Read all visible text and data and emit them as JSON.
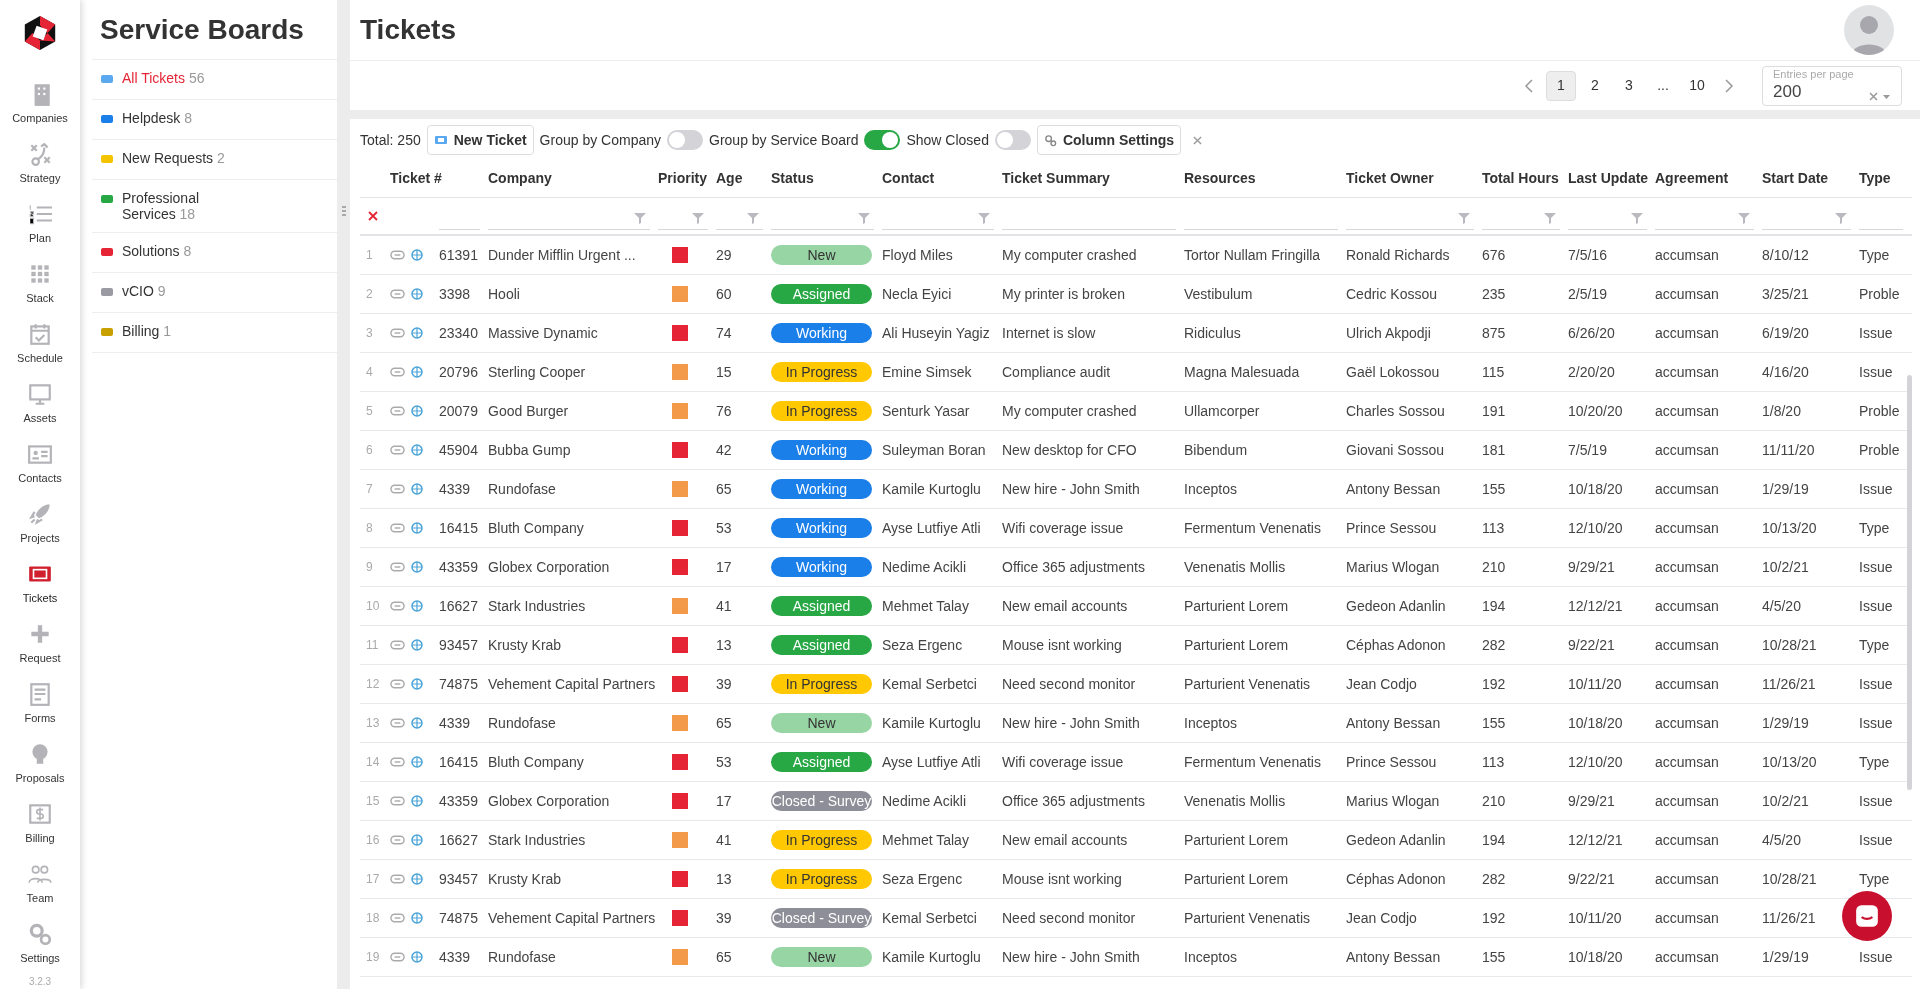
{
  "nav": {
    "items": [
      {
        "label": "Companies",
        "selected": false
      },
      {
        "label": "Strategy",
        "selected": false
      },
      {
        "label": "Plan",
        "selected": false
      },
      {
        "label": "Stack",
        "selected": false
      },
      {
        "label": "Schedule",
        "selected": false
      },
      {
        "label": "Assets",
        "selected": false
      },
      {
        "label": "Contacts",
        "selected": false
      },
      {
        "label": "Projects",
        "selected": false
      },
      {
        "label": "Tickets",
        "selected": true
      },
      {
        "label": "Request",
        "selected": false
      },
      {
        "label": "Forms",
        "selected": false
      },
      {
        "label": "Proposals",
        "selected": false
      },
      {
        "label": "Billing",
        "selected": false
      },
      {
        "label": "Team",
        "selected": false
      },
      {
        "label": "Settings",
        "selected": false
      }
    ],
    "version": "3.2.3"
  },
  "sidebar": {
    "title": "Service Boards",
    "items": [
      {
        "label": "All Tickets",
        "count": "56",
        "color": "#5aa9f0",
        "selected": true
      },
      {
        "label": "Helpdesk",
        "count": "8",
        "color": "#1a7fe8",
        "selected": false
      },
      {
        "label": "New Requests",
        "count": "2",
        "color": "#f5c400",
        "selected": false
      },
      {
        "label": "Professional Services",
        "count": "18",
        "color": "#28a745",
        "selected": false
      },
      {
        "label": "Solutions",
        "count": "8",
        "color": "#e52535",
        "selected": false
      },
      {
        "label": "vCIO",
        "count": "9",
        "color": "#9a9aa3",
        "selected": false
      },
      {
        "label": "Billing",
        "count": "1",
        "color": "#c8a000",
        "selected": false
      }
    ]
  },
  "header": {
    "title": "Tickets"
  },
  "pagination": {
    "pages": [
      {
        "label": "1",
        "selected": true
      },
      {
        "label": "2",
        "selected": false
      },
      {
        "label": "3",
        "selected": false
      },
      {
        "label": "...",
        "selected": false
      },
      {
        "label": "10",
        "selected": false
      }
    ],
    "entries_per_page": {
      "label": "Entries per page",
      "value": "200"
    }
  },
  "toolbar": {
    "total": "Total: 250",
    "new_ticket": "New Ticket",
    "toggles": [
      {
        "label": "Group by Company",
        "on": false
      },
      {
        "label": "Group by Service Board",
        "on": true
      },
      {
        "label": "Show Closed",
        "on": false
      }
    ],
    "column_settings": "Column Settings"
  },
  "table": {
    "columns": [
      {
        "label": "Ticket #",
        "filter": false
      },
      {
        "label": "Company",
        "filter": true
      },
      {
        "label": "Priority",
        "filter": true
      },
      {
        "label": "Age",
        "filter": true
      },
      {
        "label": "Status",
        "filter": true
      },
      {
        "label": "Contact",
        "filter": true
      },
      {
        "label": "Ticket Summary",
        "filter": false
      },
      {
        "label": "Resources",
        "filter": false
      },
      {
        "label": "Ticket Owner",
        "filter": true
      },
      {
        "label": "Total Hours",
        "filter": true
      },
      {
        "label": "Last Update",
        "filter": true
      },
      {
        "label": "Agreement",
        "filter": true
      },
      {
        "label": "Start Date",
        "filter": true
      },
      {
        "label": "Type",
        "filter": false
      }
    ],
    "rows": [
      {
        "num": "1",
        "ticket": "61391",
        "company": "Dunder Mifflin Urgent ...",
        "priority": {
          "color": "#e52535"
        },
        "age": "29",
        "status": {
          "label": "New",
          "color": "#98d5a4"
        },
        "contact": "Floyd Miles",
        "summary": "My computer crashed",
        "resources": "Tortor Nullam Fringilla",
        "owner": "Ronald Richards",
        "hours": "676",
        "updated": "7/5/16",
        "agreement": "accumsan",
        "start": "8/10/12",
        "type": "Type"
      },
      {
        "num": "2",
        "ticket": "3398",
        "company": "Hooli",
        "priority": {
          "color": "#f29a4a"
        },
        "age": "60",
        "status": {
          "label": "Assigned",
          "color": "#28a745"
        },
        "contact": "Necla Eyici",
        "summary": "My printer is broken",
        "resources": "Vestibulum",
        "owner": "Cedric Kossou",
        "hours": "235",
        "updated": "2/5/19",
        "agreement": "accumsan",
        "start": "3/25/21",
        "type": "Proble"
      },
      {
        "num": "3",
        "ticket": "23340",
        "company": "Massive Dynamic",
        "priority": {
          "color": "#e52535"
        },
        "age": "74",
        "status": {
          "label": "Working",
          "color": "#1a7fe8"
        },
        "contact": "Ali Huseyin Yagiz",
        "summary": "Internet is slow",
        "resources": "Ridiculus",
        "owner": "Ulrich Akpodji",
        "hours": "875",
        "updated": "6/26/20",
        "agreement": "accumsan",
        "start": "6/19/20",
        "type": "Issue"
      },
      {
        "num": "4",
        "ticket": "20796",
        "company": "Sterling Cooper",
        "priority": {
          "color": "#f29a4a"
        },
        "age": "15",
        "status": {
          "label": "In Progress",
          "color": "#ffc800"
        },
        "contact": "Emine Simsek",
        "summary": "Compliance audit",
        "resources": "Magna Malesuada",
        "owner": "Gaël Lokossou",
        "hours": "115",
        "updated": "2/20/20",
        "agreement": "accumsan",
        "start": "4/16/20",
        "type": "Issue"
      },
      {
        "num": "5",
        "ticket": "20079",
        "company": "Good Burger",
        "priority": {
          "color": "#f29a4a"
        },
        "age": "76",
        "status": {
          "label": "In Progress",
          "color": "#ffc800"
        },
        "contact": "Senturk Yasar",
        "summary": "My computer crashed",
        "resources": "Ullamcorper",
        "owner": "Charles Sossou",
        "hours": "191",
        "updated": "10/20/20",
        "agreement": "accumsan",
        "start": "1/8/20",
        "type": "Proble"
      },
      {
        "num": "6",
        "ticket": "45904",
        "company": "Bubba Gump",
        "priority": {
          "color": "#e52535"
        },
        "age": "42",
        "status": {
          "label": "Working",
          "color": "#1a7fe8"
        },
        "contact": "Suleyman Boran",
        "summary": "New desktop for CFO",
        "resources": "Bibendum",
        "owner": "Giovani Sossou",
        "hours": "181",
        "updated": "7/5/19",
        "agreement": "accumsan",
        "start": "11/11/20",
        "type": "Proble"
      },
      {
        "num": "7",
        "ticket": "4339",
        "company": "Rundofase",
        "priority": {
          "color": "#f29a4a"
        },
        "age": "65",
        "status": {
          "label": "Working",
          "color": "#1a7fe8"
        },
        "contact": "Kamile Kurtoglu",
        "summary": "New hire - John Smith",
        "resources": "Inceptos",
        "owner": "Antony Bessan",
        "hours": "155",
        "updated": "10/18/20",
        "agreement": "accumsan",
        "start": "1/29/19",
        "type": "Issue"
      },
      {
        "num": "8",
        "ticket": "16415",
        "company": "Bluth Company",
        "priority": {
          "color": "#e52535"
        },
        "age": "53",
        "status": {
          "label": "Working",
          "color": "#1a7fe8"
        },
        "contact": "Ayse Lutfiye Atli",
        "summary": "Wifi coverage issue",
        "resources": "Fermentum Venenatis",
        "owner": "Prince Sessou",
        "hours": "113",
        "updated": "12/10/20",
        "agreement": "accumsan",
        "start": "10/13/20",
        "type": "Type"
      },
      {
        "num": "9",
        "ticket": "43359",
        "company": "Globex Corporation",
        "priority": {
          "color": "#e52535"
        },
        "age": "17",
        "status": {
          "label": "Working",
          "color": "#1a7fe8"
        },
        "contact": "Nedime Acikli",
        "summary": "Office 365 adjustments",
        "resources": "Venenatis Mollis",
        "owner": "Marius Wlogan",
        "hours": "210",
        "updated": "9/29/21",
        "agreement": "accumsan",
        "start": "10/2/21",
        "type": "Issue"
      },
      {
        "num": "10",
        "ticket": "16627",
        "company": "Stark Industries",
        "priority": {
          "color": "#f29a4a"
        },
        "age": "41",
        "status": {
          "label": "Assigned",
          "color": "#28a745"
        },
        "contact": "Mehmet Talay",
        "summary": "New email accounts",
        "resources": "Parturient Lorem",
        "owner": "Gedeon Adanlin",
        "hours": "194",
        "updated": "12/12/21",
        "agreement": "accumsan",
        "start": "4/5/20",
        "type": "Issue"
      },
      {
        "num": "11",
        "ticket": "93457",
        "company": "Krusty Krab",
        "priority": {
          "color": "#e52535"
        },
        "age": "13",
        "status": {
          "label": "Assigned",
          "color": "#28a745"
        },
        "contact": "Seza Ergenc",
        "summary": "Mouse isnt working",
        "resources": "Parturient Lorem",
        "owner": "Céphas Adonon",
        "hours": "282",
        "updated": "9/22/21",
        "agreement": "accumsan",
        "start": "10/28/21",
        "type": "Type"
      },
      {
        "num": "12",
        "ticket": "74875",
        "company": "Vehement Capital Partners",
        "priority": {
          "color": "#e52535"
        },
        "age": "39",
        "status": {
          "label": "In Progress",
          "color": "#ffc800"
        },
        "contact": "Kemal Serbetci",
        "summary": "Need second monitor",
        "resources": "Parturient Venenatis",
        "owner": "Jean Codjo",
        "hours": "192",
        "updated": "10/11/20",
        "agreement": "accumsan",
        "start": "11/26/21",
        "type": "Issue"
      },
      {
        "num": "13",
        "ticket": "4339",
        "company": "Rundofase",
        "priority": {
          "color": "#f29a4a"
        },
        "age": "65",
        "status": {
          "label": "New",
          "color": "#98d5a4"
        },
        "contact": "Kamile Kurtoglu",
        "summary": "New hire - John Smith",
        "resources": "Inceptos",
        "owner": "Antony Bessan",
        "hours": "155",
        "updated": "10/18/20",
        "agreement": "accumsan",
        "start": "1/29/19",
        "type": "Issue"
      },
      {
        "num": "14",
        "ticket": "16415",
        "company": "Bluth Company",
        "priority": {
          "color": "#e52535"
        },
        "age": "53",
        "status": {
          "label": "Assigned",
          "color": "#28a745"
        },
        "contact": "Ayse Lutfiye Atli",
        "summary": "Wifi coverage issue",
        "resources": "Fermentum Venenatis",
        "owner": "Prince Sessou",
        "hours": "113",
        "updated": "12/10/20",
        "agreement": "accumsan",
        "start": "10/13/20",
        "type": "Type"
      },
      {
        "num": "15",
        "ticket": "43359",
        "company": "Globex Corporation",
        "priority": {
          "color": "#e52535"
        },
        "age": "17",
        "status": {
          "label": "Closed - Survey",
          "color": "#8e8e98"
        },
        "contact": "Nedime Acikli",
        "summary": "Office 365 adjustments",
        "resources": "Venenatis Mollis",
        "owner": "Marius Wlogan",
        "hours": "210",
        "updated": "9/29/21",
        "agreement": "accumsan",
        "start": "10/2/21",
        "type": "Issue"
      },
      {
        "num": "16",
        "ticket": "16627",
        "company": "Stark Industries",
        "priority": {
          "color": "#f29a4a"
        },
        "age": "41",
        "status": {
          "label": "In Progress",
          "color": "#ffc800"
        },
        "contact": "Mehmet Talay",
        "summary": "New email accounts",
        "resources": "Parturient Lorem",
        "owner": "Gedeon Adanlin",
        "hours": "194",
        "updated": "12/12/21",
        "agreement": "accumsan",
        "start": "4/5/20",
        "type": "Issue"
      },
      {
        "num": "17",
        "ticket": "93457",
        "company": "Krusty Krab",
        "priority": {
          "color": "#e52535"
        },
        "age": "13",
        "status": {
          "label": "In Progress",
          "color": "#ffc800"
        },
        "contact": "Seza Ergenc",
        "summary": "Mouse isnt working",
        "resources": "Parturient Lorem",
        "owner": "Céphas Adonon",
        "hours": "282",
        "updated": "9/22/21",
        "agreement": "accumsan",
        "start": "10/28/21",
        "type": "Type"
      },
      {
        "num": "18",
        "ticket": "74875",
        "company": "Vehement Capital Partners",
        "priority": {
          "color": "#e52535"
        },
        "age": "39",
        "status": {
          "label": "Closed - Survey",
          "color": "#8e8e98"
        },
        "contact": "Kemal Serbetci",
        "summary": "Need second monitor",
        "resources": "Parturient Venenatis",
        "owner": "Jean Codjo",
        "hours": "192",
        "updated": "10/11/20",
        "agreement": "accumsan",
        "start": "11/26/21"
      },
      {
        "num": "19",
        "ticket": "4339",
        "company": "Rundofase",
        "priority": {
          "color": "#f29a4a"
        },
        "age": "65",
        "status": {
          "label": "New",
          "color": "#98d5a4"
        },
        "contact": "Kamile Kurtoglu",
        "summary": "New hire - John Smith",
        "resources": "Inceptos",
        "owner": "Antony Bessan",
        "hours": "155",
        "updated": "10/18/20",
        "agreement": "accumsan",
        "start": "1/29/19",
        "type": "Issue"
      }
    ]
  }
}
